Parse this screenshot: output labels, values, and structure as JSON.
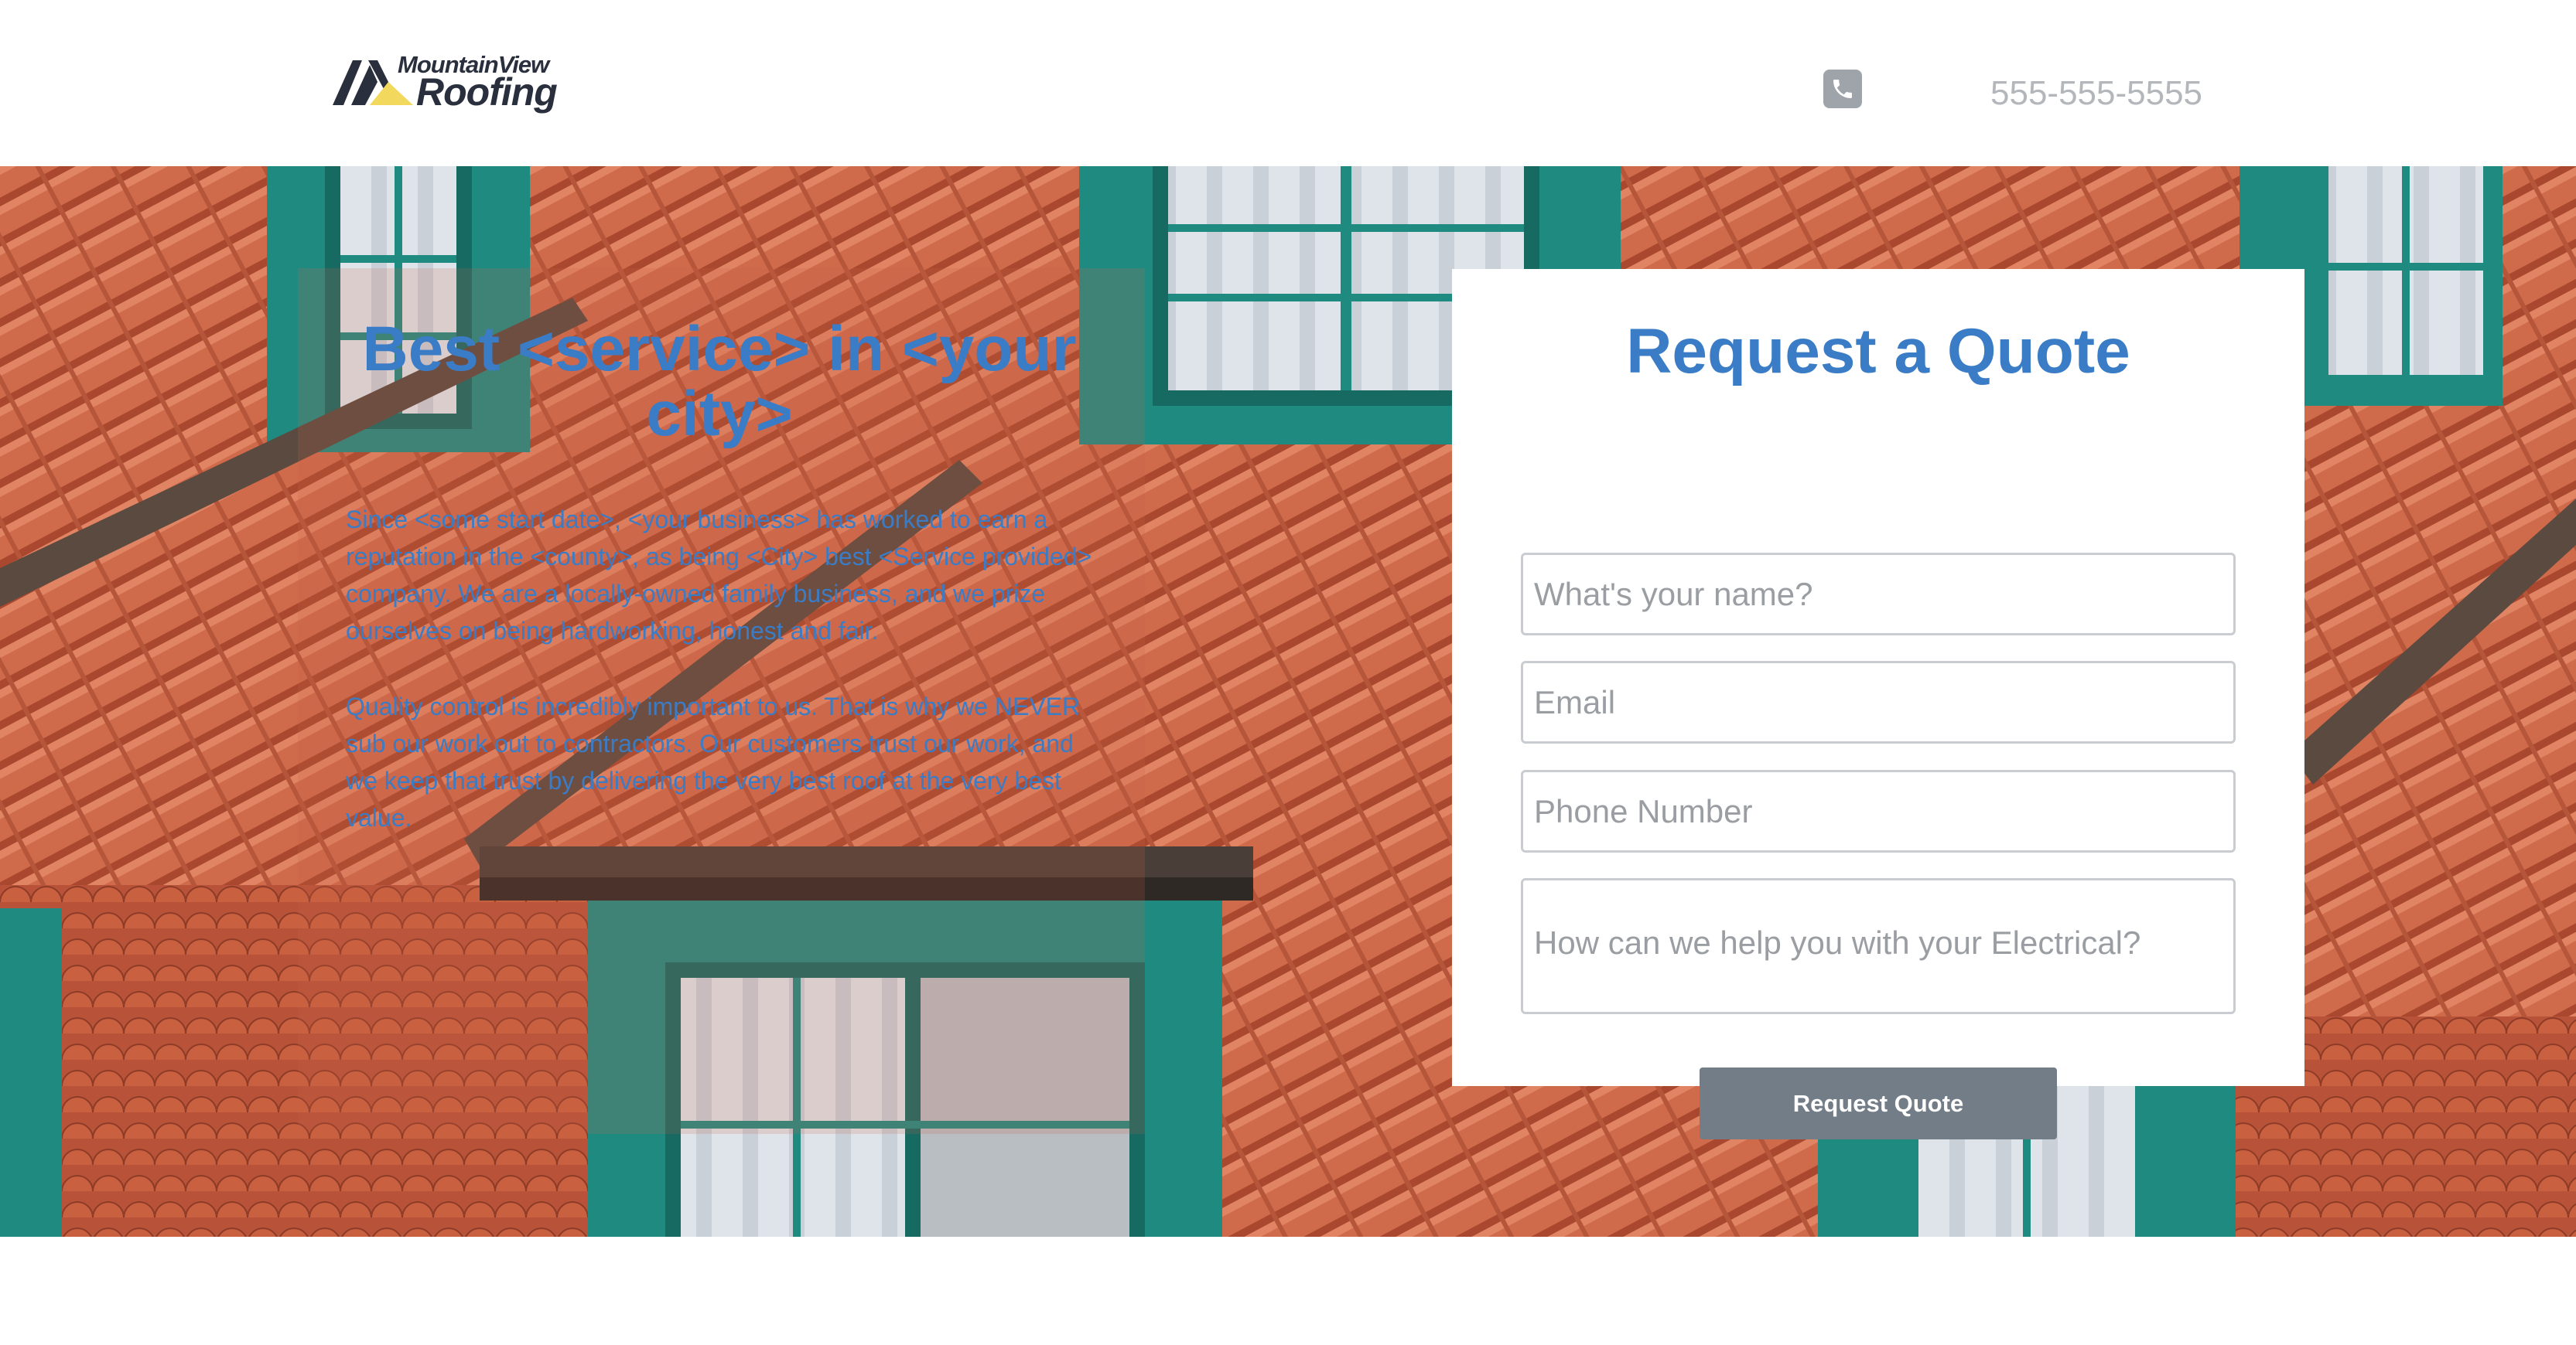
{
  "brand": {
    "logo_line1": "MountainView",
    "logo_line2": "Roofing",
    "logo_colors": {
      "mountain": "#2a2f3d",
      "sun": "#f2d85c"
    }
  },
  "header": {
    "phone_icon": "phone-icon",
    "phone_number": "555-555-5555"
  },
  "hero": {
    "title": "Best <service> in <your city>",
    "paragraph1": "Since <some start date>, <your business> has worked to earn a reputation in the <county>, as being <City> best <Service provided> company. We are a locally-owned family business, and we prize ourselves on being hardworking, honest and fair.",
    "paragraph2": "Quality control is incredibly important to us. That is why we NEVER sub our work out to contractors. Our customers trust our work, and we keep that trust by delivering the very best roof at the very best value.",
    "background": "terracotta roof tiles with teal dormer windows"
  },
  "quote_form": {
    "title": "Request a Quote",
    "name_placeholder": "What's your name?",
    "email_placeholder": "Email",
    "phone_placeholder": "Phone Number",
    "message_placeholder": "How can we help you with your Electrical?",
    "submit_label": "Request Quote"
  },
  "colors": {
    "accent_blue": "#3a7cc6",
    "button_gray": "#737d87",
    "roof_tile": "#cc6648",
    "window_teal": "#1f8a80"
  }
}
